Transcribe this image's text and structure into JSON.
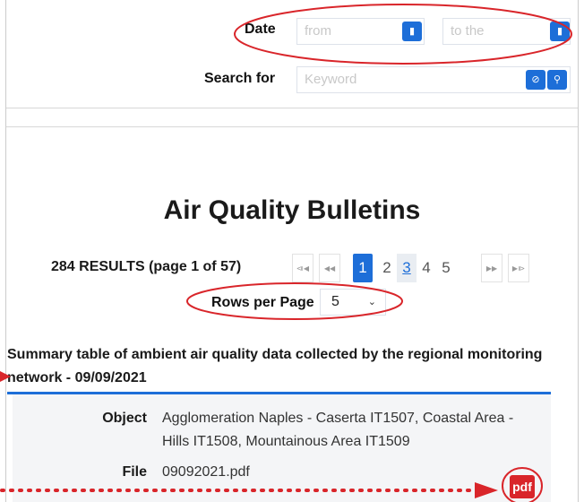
{
  "filters": {
    "date_label": "Date",
    "from_placeholder": "from",
    "to_placeholder": "to the",
    "search_label": "Search for",
    "keyword_placeholder": "Keyword"
  },
  "page_title": "Air Quality Bulletins",
  "pagination": {
    "results_text": "284 RESULTS (page 1 of 57)",
    "first": "⧏◀",
    "prev": "◀◀",
    "pages": [
      "1",
      "2",
      "3",
      "4",
      "5"
    ],
    "next": "▶▶",
    "last": "▶⧐",
    "current_page": "1"
  },
  "rows_per_page": {
    "label": "Rows per Page",
    "value": "5"
  },
  "bulletin": {
    "summary": "Summary table of ambient air quality data collected by the regional monitoring network - 09/09/2021",
    "object_label": "Object",
    "object_value": "Agglomeration Naples - Caserta IT1507, Coastal Area - Hills IT1508, Mountainous Area IT1509",
    "file_label": "File",
    "file_value": "09092021.pdf",
    "pdf_icon_text": "pdf"
  },
  "colors": {
    "accent": "#1d6ed8",
    "annotation": "#d9252a",
    "pdf": "#d9252a"
  },
  "icons": {
    "calendar": "calendar-icon",
    "clear": "clear-icon",
    "search": "search-icon",
    "pdf": "pdf-icon"
  }
}
